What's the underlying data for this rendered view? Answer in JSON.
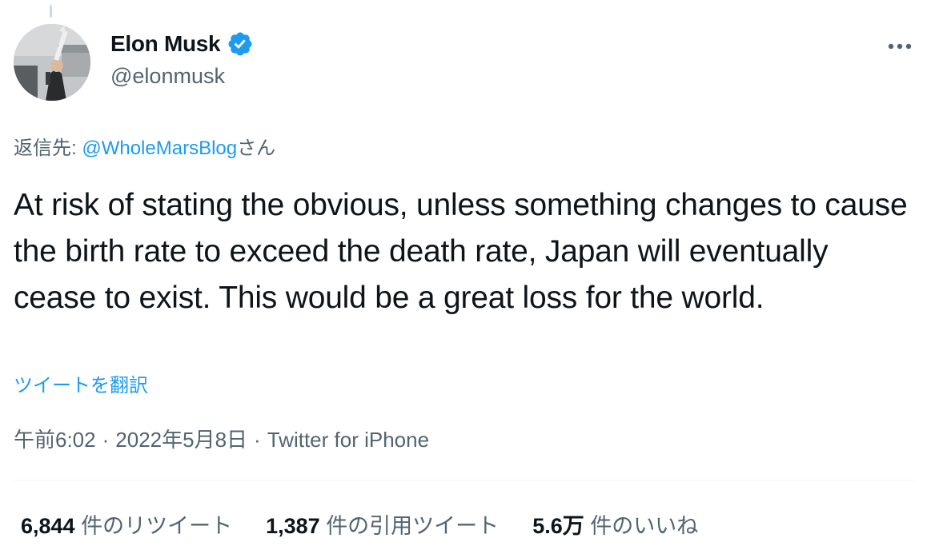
{
  "author": {
    "display_name": "Elon Musk",
    "handle": "@elonmusk",
    "verified": true,
    "avatar_icon": "profile-photo"
  },
  "reply": {
    "prefix": "返信先: ",
    "mention": "@WholeMarsBlog",
    "suffix": "さん"
  },
  "tweet": {
    "text": "At risk of stating the obvious, unless something changes to cause the birth rate to exceed the death rate, Japan will eventually cease to exist. This would be a great loss for the world.",
    "translate_label": "ツイートを翻訳"
  },
  "meta": {
    "time": "午前6:02",
    "separator": "·",
    "date": "2022年5月8日",
    "source": "Twitter for iPhone"
  },
  "stats": {
    "retweets": {
      "count": "6,844",
      "label": "件のリツイート"
    },
    "quotes": {
      "count": "1,387",
      "label": "件の引用ツイート"
    },
    "likes": {
      "count": "5.6万",
      "label": "件のいいね"
    }
  },
  "colors": {
    "accent": "#1d9bf0",
    "text": "#0f1419",
    "secondary": "#536471",
    "divider": "#eff3f4"
  }
}
